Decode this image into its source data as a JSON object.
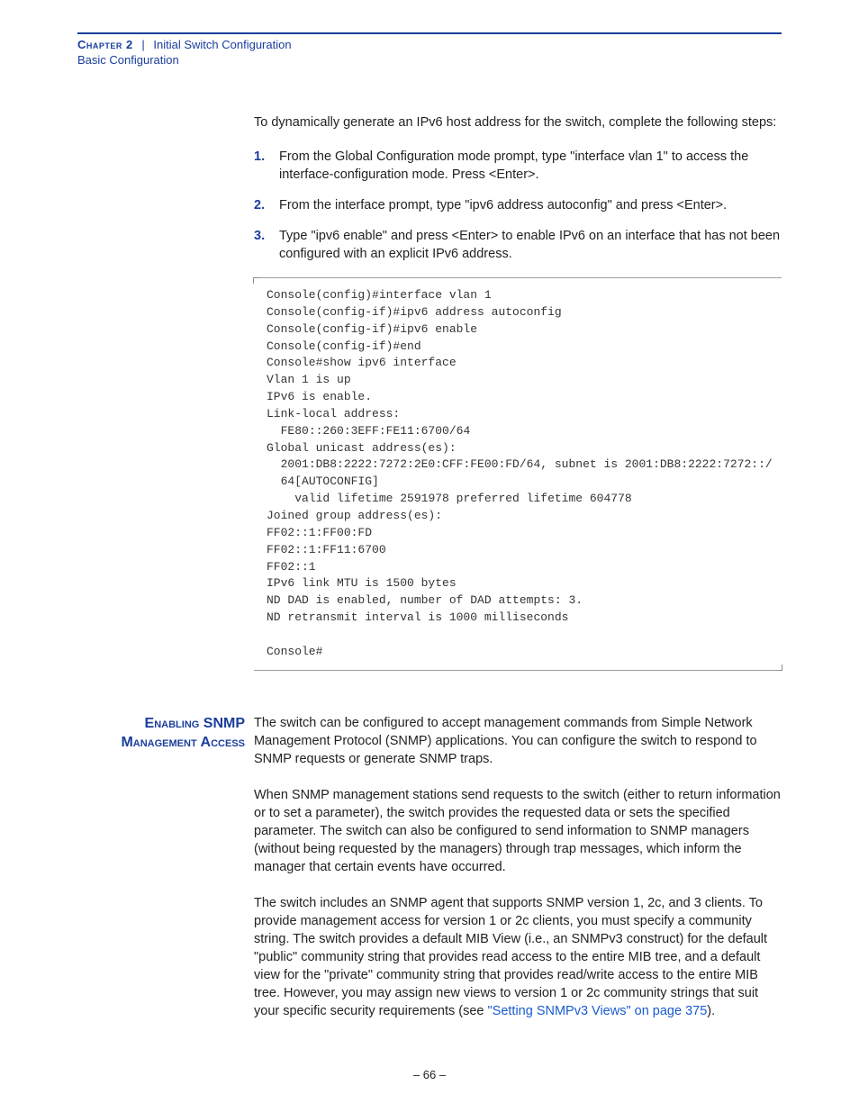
{
  "header": {
    "chapter_label": "Chapter 2",
    "separator": "|",
    "chapter_title": "Initial Switch Configuration",
    "section_title": "Basic Configuration"
  },
  "intro": "To dynamically generate an IPv6 host address for the switch, complete the following steps:",
  "steps": [
    "From the Global Configuration mode prompt, type \"interface vlan 1\" to access the interface-configuration mode. Press <Enter>.",
    "From the interface prompt, type \"ipv6 address autoconfig\" and press <Enter>.",
    "Type \"ipv6 enable\" and press <Enter> to enable IPv6 on an interface that has not been configured with an explicit IPv6 address."
  ],
  "console": "Console(config)#interface vlan 1\nConsole(config-if)#ipv6 address autoconfig\nConsole(config-if)#ipv6 enable\nConsole(config-if)#end\nConsole#show ipv6 interface\nVlan 1 is up\nIPv6 is enable.\nLink-local address:\n  FE80::260:3EFF:FE11:6700/64\nGlobal unicast address(es):\n  2001:DB8:2222:7272:2E0:CFF:FE00:FD/64, subnet is 2001:DB8:2222:7272::/\n  64[AUTOCONFIG]\n    valid lifetime 2591978 preferred lifetime 604778\nJoined group address(es):\nFF02::1:FF00:FD\nFF02::1:FF11:6700\nFF02::1\nIPv6 link MTU is 1500 bytes\nND DAD is enabled, number of DAD attempts: 3.\nND retransmit interval is 1000 milliseconds\n\nConsole#",
  "snmp": {
    "heading_line1": "Enabling SNMP",
    "heading_line2": "Management Access",
    "para1": "The switch can be configured to accept management commands from Simple Network Management Protocol (SNMP) applications. You can configure the switch to respond to SNMP requests or generate SNMP traps.",
    "para2": "When SNMP management stations send requests to the switch (either to return information or to set a parameter), the switch provides the requested data or sets the specified parameter. The switch can also be configured to send information to SNMP managers (without being requested by the managers) through trap messages, which inform the manager that certain events have occurred.",
    "para3_pre": "The switch includes an SNMP agent that supports SNMP version 1, 2c, and 3 clients. To provide management access for version 1 or 2c clients, you must specify a community string. The switch provides a default MIB View (i.e., an SNMPv3 construct) for the default \"public\" community string that provides read access to the entire MIB tree, and a default view for the \"private\" community string that provides read/write access to the entire MIB tree. However, you may assign new views to version 1 or 2c community strings that suit your specific security requirements (see ",
    "para3_link": "\"Setting SNMPv3 Views\" on page 375",
    "para3_post": ")."
  },
  "page_number": "– 66 –"
}
